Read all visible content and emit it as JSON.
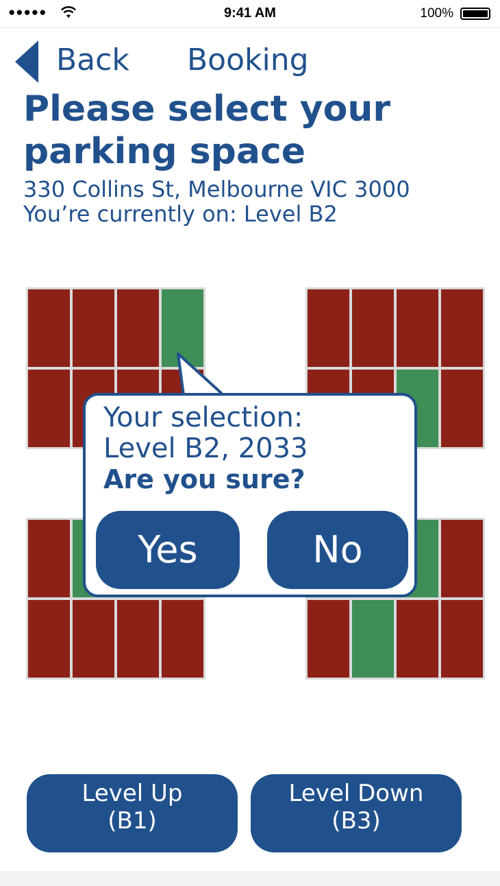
{
  "status_bar": {
    "signal": "●●●●●",
    "time": "9:41 AM",
    "battery": "100%"
  },
  "nav": {
    "back_label": "Back",
    "title": "Booking"
  },
  "page": {
    "heading": "Please select your parking space",
    "address": "330 Collins St, Melbourne VIC 3000",
    "current_level": "You’re currently on: Level B2"
  },
  "parking_map": {
    "colors": {
      "occupied": "#8b2117",
      "available": "#3f8d57",
      "border": "#d9d9d9"
    },
    "lots": [
      {
        "name": "top-left",
        "spaces": [
          "occupied",
          "occupied",
          "occupied",
          "available",
          "occupied",
          "occupied",
          "occupied",
          "occupied"
        ]
      },
      {
        "name": "top-right",
        "spaces": [
          "occupied",
          "occupied",
          "occupied",
          "occupied",
          "occupied",
          "occupied",
          "available",
          "occupied"
        ]
      },
      {
        "name": "bottom-left",
        "spaces": [
          "occupied",
          "available",
          "available",
          "available",
          "occupied",
          "occupied",
          "occupied",
          "occupied"
        ]
      },
      {
        "name": "bottom-right",
        "spaces": [
          "occupied",
          "occupied",
          "available",
          "occupied",
          "occupied",
          "available",
          "occupied",
          "occupied"
        ]
      }
    ]
  },
  "dialog": {
    "line1": "Your selection:",
    "line2": "Level B2, 2033",
    "question": "Are you sure?",
    "yes_label": "Yes",
    "no_label": "No"
  },
  "level_buttons": {
    "up_line1": "Level Up",
    "up_line2": "(B1)",
    "down_line1": "Level Down",
    "down_line2": "(B3)"
  },
  "accent_color": "#21518d"
}
